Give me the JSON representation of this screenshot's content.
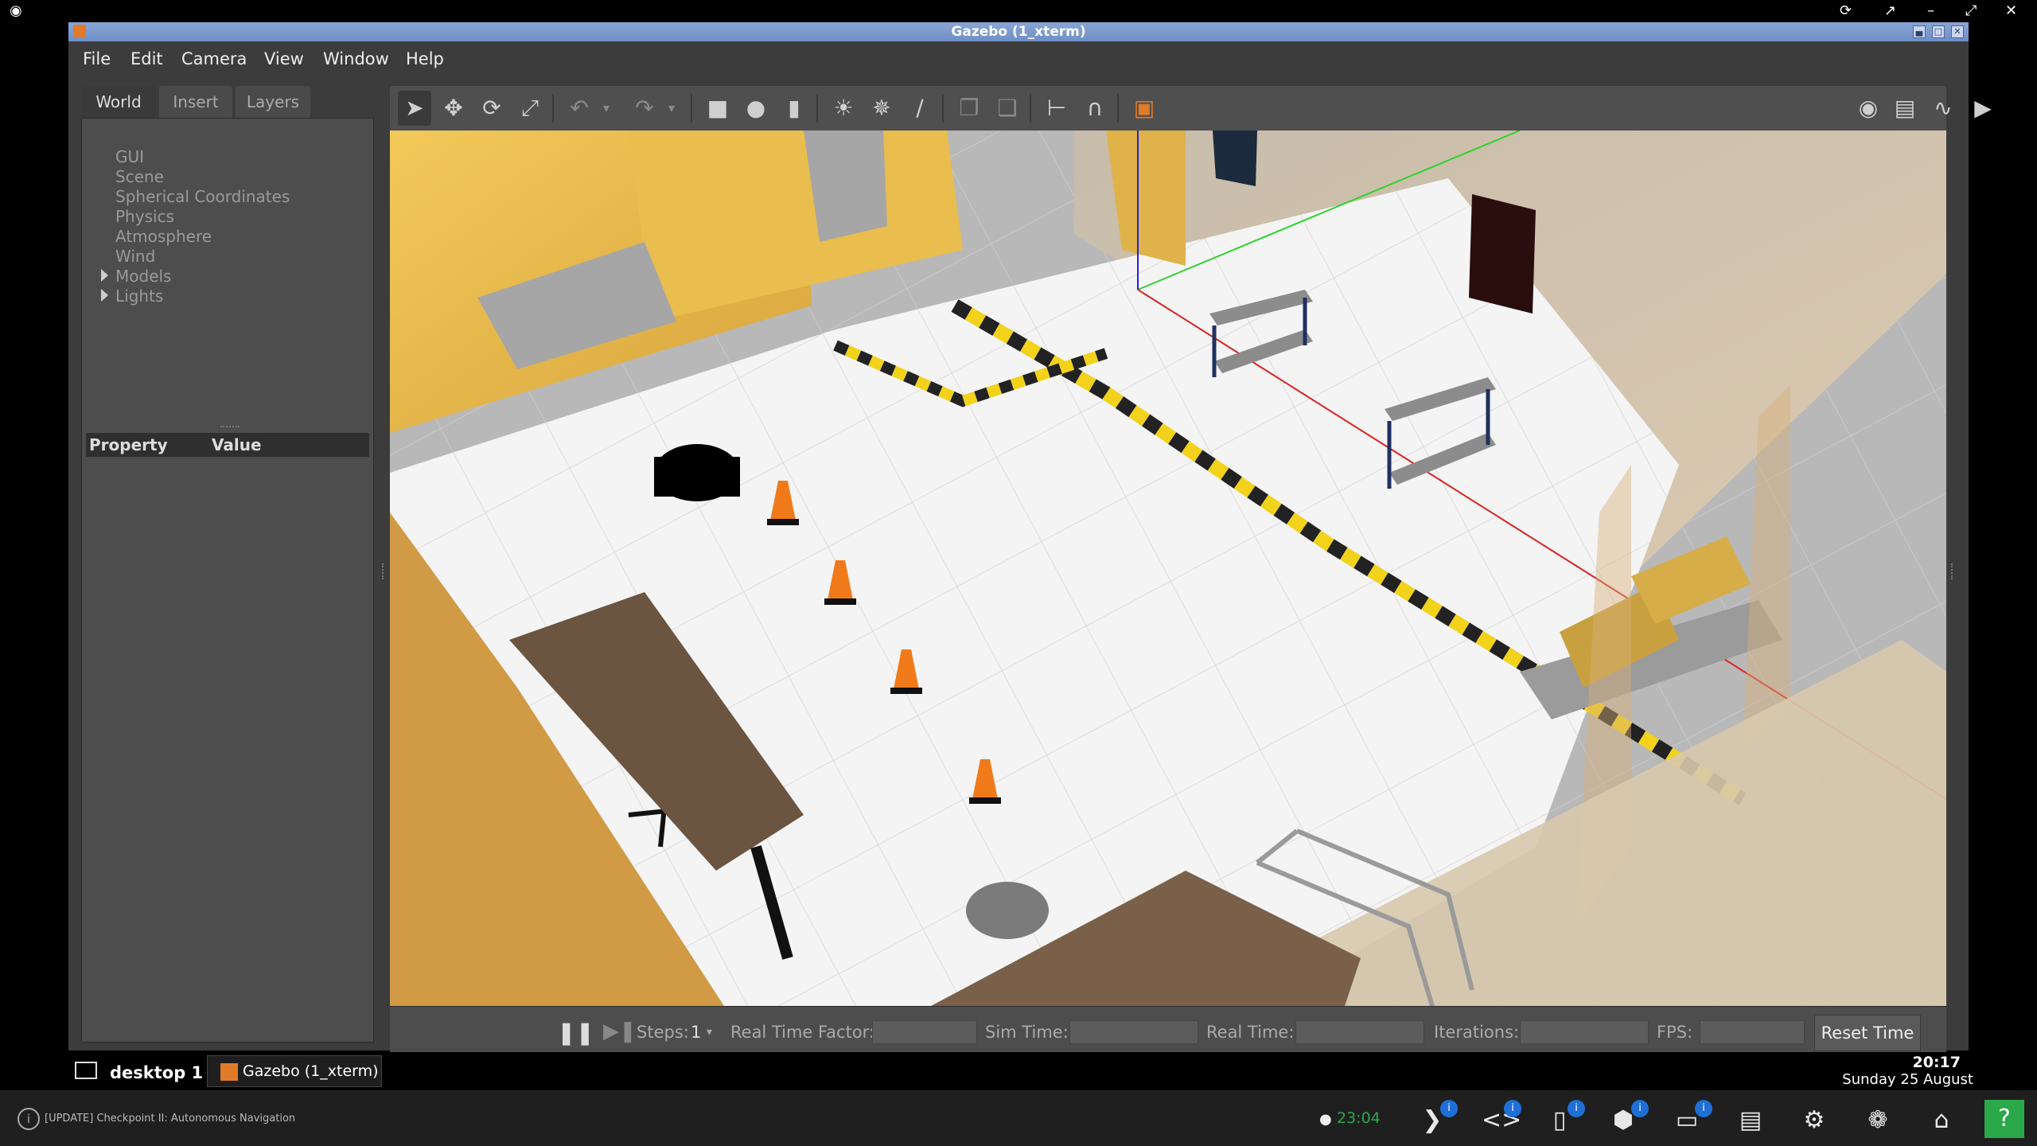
{
  "window": {
    "title": "Gazebo (1_xterm)"
  },
  "menu": [
    "File",
    "Edit",
    "Camera",
    "View",
    "Window",
    "Help"
  ],
  "left_panel": {
    "tabs": [
      "World",
      "Insert",
      "Layers"
    ],
    "tree": [
      "GUI",
      "Scene",
      "Spherical Coordinates",
      "Physics",
      "Atmosphere",
      "Wind",
      "Models",
      "Lights"
    ],
    "property_header": {
      "property": "Property",
      "value": "Value"
    }
  },
  "toolbar": {
    "icons": [
      "select-icon",
      "translate-icon",
      "rotate-icon",
      "scale-icon",
      "undo-icon",
      "undo-dropdown-icon",
      "redo-icon",
      "redo-dropdown-icon",
      "box-icon",
      "sphere-icon",
      "cylinder-icon",
      "point-light-icon",
      "spot-light-icon",
      "directional-light-icon",
      "copy-icon",
      "paste-icon",
      "align-icon",
      "snap-icon",
      "view-angle-icon",
      "screenshot-icon",
      "log-icon",
      "plot-icon",
      "record-icon"
    ]
  },
  "bottom_bar": {
    "steps_label": "Steps:",
    "steps_value": "1",
    "rtf_label": "Real Time Factor:",
    "sim_time_label": "Sim Time:",
    "real_time_label": "Real Time:",
    "iterations_label": "Iterations:",
    "fps_label": "FPS:",
    "reset_button": "Reset Time"
  },
  "taskbar": {
    "desktop": "desktop 1",
    "app_button": "Gazebo (1_xterm)",
    "time": "20:17",
    "date": "Sunday 25 August"
  },
  "dock": {
    "notification": "[UPDATE] Checkpoint II: Autonomous Navigation",
    "timer": "23:04",
    "help": "?"
  },
  "colors": {
    "accent": "#1f6fd6",
    "help_green": "#2aa84a",
    "timer_green": "#2aa84a",
    "title_blue": "#7f9bd0"
  }
}
